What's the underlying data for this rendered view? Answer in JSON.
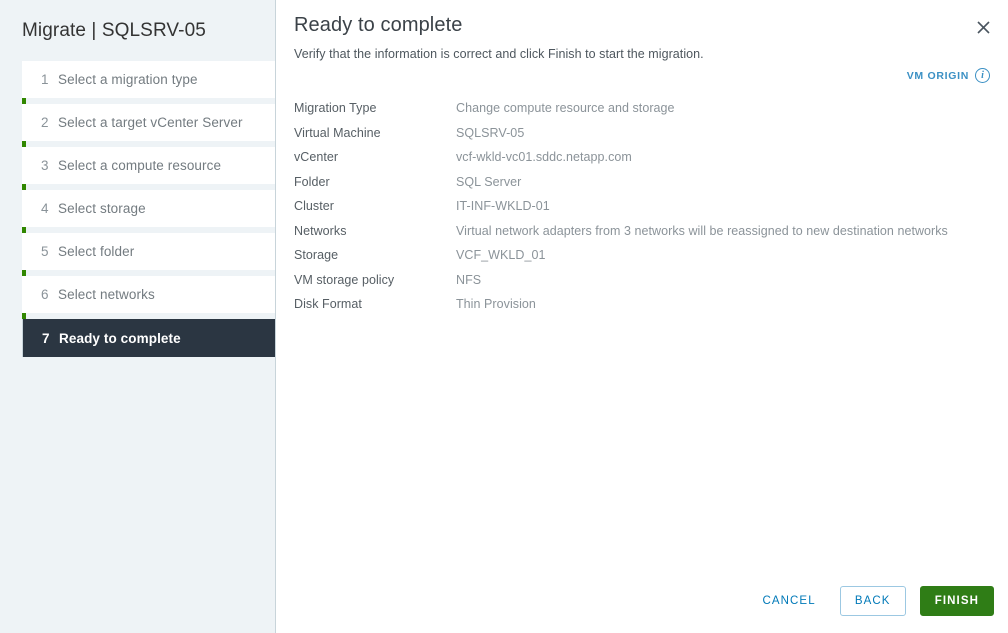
{
  "sidebar": {
    "title": "Migrate | SQLSRV-05",
    "accent_color": "#318700",
    "active_step_bg": "#2b3642",
    "steps": [
      {
        "num": "1",
        "label": "Select a migration type",
        "active": false
      },
      {
        "num": "2",
        "label": "Select a target vCenter Server",
        "active": false
      },
      {
        "num": "3",
        "label": "Select a compute resource",
        "active": false
      },
      {
        "num": "4",
        "label": "Select storage",
        "active": false
      },
      {
        "num": "5",
        "label": "Select folder",
        "active": false
      },
      {
        "num": "6",
        "label": "Select networks",
        "active": false
      },
      {
        "num": "7",
        "label": "Ready to complete",
        "active": true
      }
    ]
  },
  "main": {
    "title": "Ready to complete",
    "subtitle": "Verify that the information is correct and click Finish to start the migration.",
    "close_icon": "close-icon",
    "vm_origin": {
      "label": "VM ORIGIN",
      "icon": "info-icon",
      "color": "#3b90c4"
    },
    "summary": [
      {
        "label": "Migration Type",
        "value": "Change compute resource and storage"
      },
      {
        "label": "Virtual Machine",
        "value": "SQLSRV-05"
      },
      {
        "label": "vCenter",
        "value": "vcf-wkld-vc01.sddc.netapp.com"
      },
      {
        "label": "Folder",
        "value": "SQL Server"
      },
      {
        "label": "Cluster",
        "value": "IT-INF-WKLD-01"
      },
      {
        "label": "Networks",
        "value": "Virtual network adapters from 3 networks will be reassigned to new destination networks"
      },
      {
        "label": "Storage",
        "value": "VCF_WKLD_01"
      },
      {
        "label": "VM storage policy",
        "value": "NFS"
      },
      {
        "label": "Disk Format",
        "value": "Thin Provision"
      }
    ]
  },
  "footer": {
    "cancel_label": "CANCEL",
    "back_label": "BACK",
    "finish_label": "FINISH",
    "link_color": "#0079b8",
    "finish_color": "#2f7d16"
  }
}
